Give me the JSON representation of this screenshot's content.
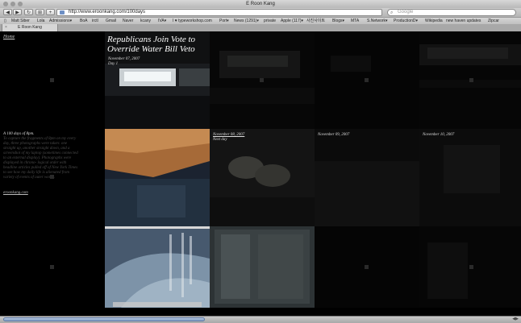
{
  "window": {
    "title": "E Roon Kang"
  },
  "toolbar": {
    "back_glyph": "◀",
    "forward_glyph": "▶",
    "reload_glyph": "↻",
    "bookmark_glyph": "⊞",
    "add_glyph": "+",
    "url": "http://www.eroonkang.com/100days",
    "search_placeholder": "Google"
  },
  "bookmarks": [
    "Matt Siber",
    "Lola",
    "Admissions▾",
    "BoA",
    "irctl",
    "Gmail",
    "Naver",
    "kcany",
    "IVA▾",
    "I ♥ typeworkshop.com",
    "Port▾",
    "News (1291)▾",
    "private",
    "Apple (117)▾",
    "사진사이트",
    "Blogs▾",
    "MTA",
    "S.Network▾",
    "ProductionD▾",
    "Wikipedia",
    "new haven updates",
    "Zipcar"
  ],
  "tabs": [
    {
      "label": "E Roon Kang"
    }
  ],
  "page": {
    "home_link": "Home",
    "about": {
      "heading": "A 100 days of 8pm.",
      "description": "To capture the fragments of 8pm on my every day, three photographs were taken: one straight up, another straight down, and a screenshot of my laptop (sometimes connected to an external display). Photographs were displayed in chrono- logical order with headline articles pulled off of New York Times to see how my daily life is alienated from variety of events of outer world."
    },
    "site_link": "eroonkang.com",
    "days": [
      {
        "date": "November 07, 2007",
        "label": "Day 1",
        "headline": "Republicans Join Vote to Override Water Bill Veto"
      },
      {
        "date": "November 08, 2007",
        "label": "Next day"
      },
      {
        "date": "November 09, 2007"
      },
      {
        "date": "November 10, 2007"
      }
    ]
  },
  "colors": {
    "background": "#000000",
    "text_light": "#dddddd",
    "text_dim": "#4a4a4a"
  },
  "icons": [
    "back-icon",
    "forward-icon",
    "reload-icon",
    "bookmark-icon",
    "add-icon",
    "site-icon",
    "search-icon",
    "close-tab-icon"
  ]
}
